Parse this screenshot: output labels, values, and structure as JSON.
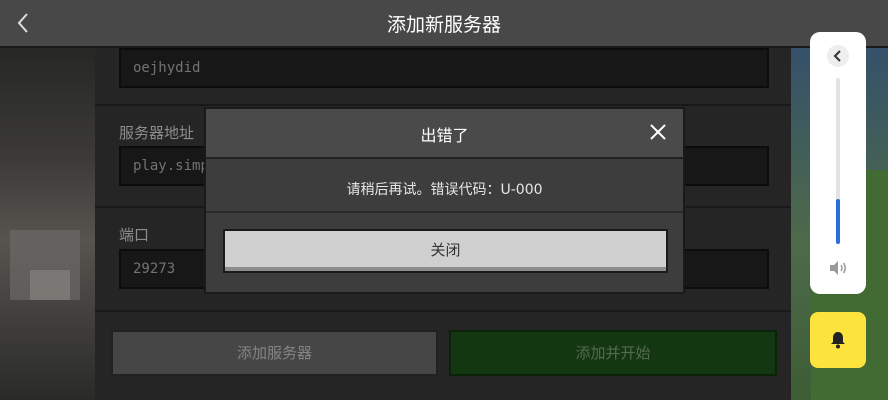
{
  "header": {
    "title": "添加新服务器"
  },
  "form": {
    "name_value": "oejhydid",
    "address_label": "服务器地址",
    "address_value": "play.simp",
    "port_label": "端口",
    "port_value": "29273",
    "add_server_label": "添加服务器",
    "add_and_start_label": "添加并开始"
  },
  "dialog": {
    "title": "出错了",
    "message": "请稍后再试。错误代码：U-000",
    "close_button_label": "关闭"
  },
  "volume_panel": {
    "level": 0.27
  },
  "colors": {
    "volume_fill": "#2a6fe0",
    "bell_button": "#fce33d",
    "start_button": "#1a4a16"
  },
  "icons": {
    "back": "chevron-left-icon",
    "close": "close-icon",
    "speaker": "speaker-icon",
    "bell": "bell-icon"
  }
}
